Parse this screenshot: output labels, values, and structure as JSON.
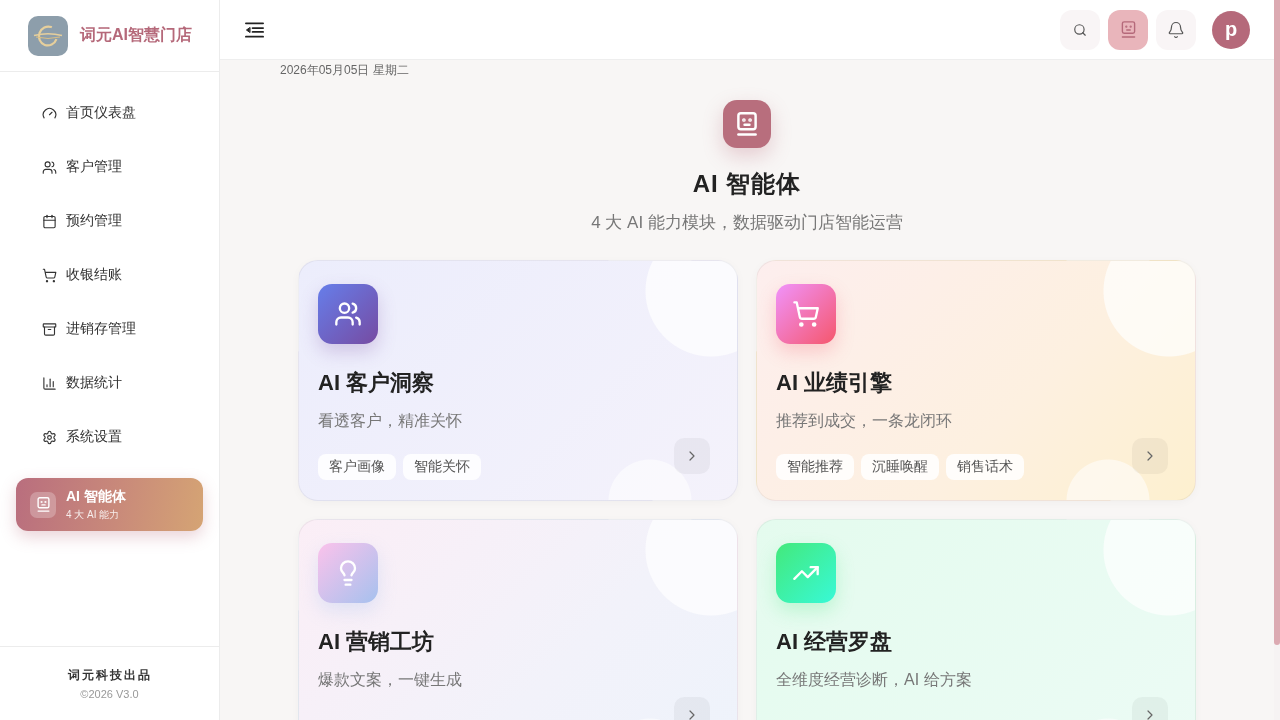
{
  "sidebar": {
    "brand": "词元AI智慧门店",
    "nav": [
      {
        "label": "首页仪表盘",
        "selected": false
      },
      {
        "label": "客户管理",
        "selected": false
      },
      {
        "label": "预约管理",
        "selected": false
      },
      {
        "label": "收银结账",
        "selected": false
      },
      {
        "label": "进销存管理",
        "selected": false
      },
      {
        "label": "数据统计",
        "selected": false
      },
      {
        "label": "系统设置",
        "selected": false
      },
      {
        "label": "AI 智能体",
        "subtitle": "4 大 AI 能力",
        "selected": true
      }
    ],
    "footer": {
      "maker": "词元科技出品",
      "version": "©2026 V3.0"
    }
  },
  "topbar": {
    "buttons": [
      {
        "selected": false
      },
      {
        "selected": true
      },
      {
        "selected": false
      }
    ],
    "avatar": "p"
  },
  "date": "2026年05月05日 星期二",
  "hero": {
    "title": "AI 智能体",
    "subtitle": "4 大 AI 能力模块，数据驱动门店智能运营"
  },
  "cards": [
    {
      "title": "AI 客户洞察",
      "description": "看透客户，精准关怀",
      "tags": [
        "客户画像",
        "智能关怀"
      ]
    },
    {
      "title": "AI 业绩引擎",
      "description": "推荐到成交，一条龙闭环",
      "tags": [
        "智能推荐",
        "沉睡唤醒",
        "销售话术"
      ]
    },
    {
      "title": "AI 营销工坊",
      "description": "爆款文案，一键生成"
    },
    {
      "title": "AI 经营罗盘",
      "description": "全维度经营诊断，AI 给方案"
    }
  ]
}
